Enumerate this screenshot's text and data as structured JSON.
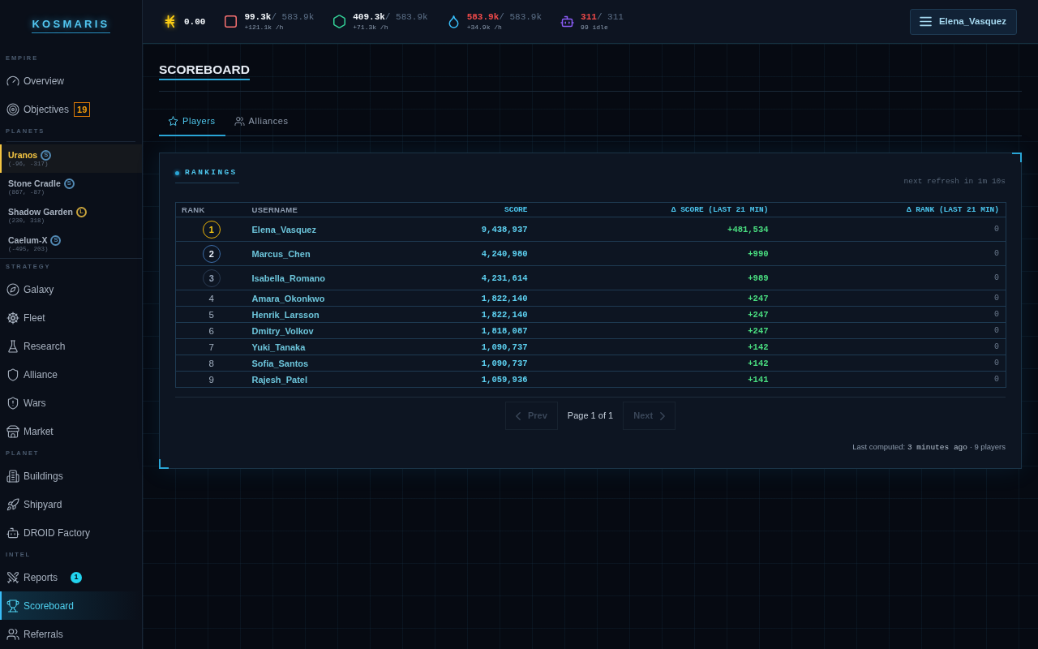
{
  "sidebar": {
    "logo": "KOSMARIS",
    "sections": [
      {
        "kind": "nav",
        "label": "EMPIRE",
        "items": [
          {
            "label": "Overview",
            "selected": false
          },
          {
            "label": "Objectives",
            "selected": false,
            "badge": {
              "kind": "outline",
              "text": "19"
            }
          }
        ]
      },
      {
        "kind": "planets",
        "label": "PLANETS",
        "items": [
          {
            "label": "Uranos",
            "coords": "(-96, -317)",
            "badge": {
              "text": "S",
              "color": "#5289b3"
            },
            "selected": true
          },
          {
            "label": "Stone Cradle",
            "coords": "(867, -87)",
            "badge": {
              "text": "S",
              "color": "#5289b3"
            },
            "selected": false
          },
          {
            "label": "Shadow Garden",
            "coords": "(230, 318)",
            "badge": {
              "text": "L",
              "color": "#c9a43c"
            },
            "selected": false
          },
          {
            "label": "Caelum-X",
            "coords": "(-495, 203)",
            "badge": {
              "text": "S",
              "color": "#5289b3"
            },
            "selected": false
          }
        ]
      },
      {
        "kind": "nav",
        "label": "STRATEGY",
        "items": [
          {
            "label": "Galaxy",
            "selected": false
          },
          {
            "label": "Fleet",
            "selected": false
          },
          {
            "label": "Research",
            "selected": false
          },
          {
            "label": "Alliance",
            "selected": false
          },
          {
            "label": "Wars",
            "selected": false
          },
          {
            "label": "Market",
            "selected": false
          }
        ]
      },
      {
        "kind": "nav",
        "label": "PLANET",
        "items": [
          {
            "label": "Buildings",
            "selected": false
          },
          {
            "label": "Shipyard",
            "selected": false
          },
          {
            "label": "DROID Factory",
            "selected": false
          }
        ]
      },
      {
        "kind": "nav",
        "label": "INTEL",
        "items": [
          {
            "label": "Reports",
            "selected": false,
            "badge": {
              "kind": "dot",
              "text": "1"
            }
          },
          {
            "label": "Scoreboard",
            "selected": true
          },
          {
            "label": "Referrals",
            "selected": false
          }
        ]
      }
    ]
  },
  "topbar": {
    "resources": [
      {
        "amount": "0.00",
        "full": false
      },
      {
        "amount": "99.3k",
        "capacity": "/ 583.9k",
        "detail": "+121.1k /h",
        "full": false
      },
      {
        "amount": "409.3k",
        "capacity": "/ 583.9k",
        "detail": "+71.3k /h",
        "full": false
      },
      {
        "amount": "583.9k",
        "capacity": "/ 583.9k",
        "detail": "+34.9k /h",
        "full": true
      },
      {
        "amount": "311",
        "capacity": "/ 311",
        "detail": "99 idle",
        "full": true
      }
    ],
    "user_menu": {
      "label": "Elena_Vasquez"
    }
  },
  "page": {
    "title": "SCOREBOARD",
    "tabs": [
      {
        "label": "Players",
        "selected": true
      },
      {
        "label": "Alliances",
        "selected": false
      }
    ]
  },
  "rankings": {
    "title": "RANKINGS",
    "refresh": "next refresh in 1m 10s",
    "table": {
      "columns": [
        "RANK",
        "USERNAME",
        "SCORE",
        "Δ SCORE (LAST 21 MIN)",
        "Δ RANK (LAST 21 MIN)"
      ],
      "rows": [
        {
          "kind": "gold",
          "rank": "1",
          "username": "Elena_Vasquez",
          "score": "9,438,937",
          "score_change": "+481,534",
          "rank_change": "0"
        },
        {
          "kind": "silver",
          "rank": "2",
          "username": "Marcus_Chen",
          "score": "4,240,980",
          "score_change": "+990",
          "rank_change": "0"
        },
        {
          "kind": "bronze",
          "rank": "3",
          "username": "Isabella_Romano",
          "score": "4,231,614",
          "score_change": "+989",
          "rank_change": "0"
        },
        {
          "kind": "plain",
          "rank": "4",
          "username": "Amara_Okonkwo",
          "score": "1,822,140",
          "score_change": "+247",
          "rank_change": "0"
        },
        {
          "kind": "plain",
          "rank": "5",
          "username": "Henrik_Larsson",
          "score": "1,822,140",
          "score_change": "+247",
          "rank_change": "0"
        },
        {
          "kind": "plain",
          "rank": "6",
          "username": "Dmitry_Volkov",
          "score": "1,818,087",
          "score_change": "+247",
          "rank_change": "0"
        },
        {
          "kind": "plain",
          "rank": "7",
          "username": "Yuki_Tanaka",
          "score": "1,090,737",
          "score_change": "+142",
          "rank_change": "0"
        },
        {
          "kind": "plain",
          "rank": "8",
          "username": "Sofia_Santos",
          "score": "1,090,737",
          "score_change": "+142",
          "rank_change": "0"
        },
        {
          "kind": "plain",
          "rank": "9",
          "username": "Rajesh_Patel",
          "score": "1,059,936",
          "score_change": "+141",
          "rank_change": "0"
        }
      ]
    },
    "pagination": {
      "prev": {
        "label": "Prev",
        "disabled": true
      },
      "page": "Page 1 of 1",
      "next": {
        "label": "Next",
        "disabled": true
      }
    },
    "footer": {
      "label": "Last computed:",
      "time": "3 minutes ago",
      "summary": "· 9 players"
    }
  }
}
